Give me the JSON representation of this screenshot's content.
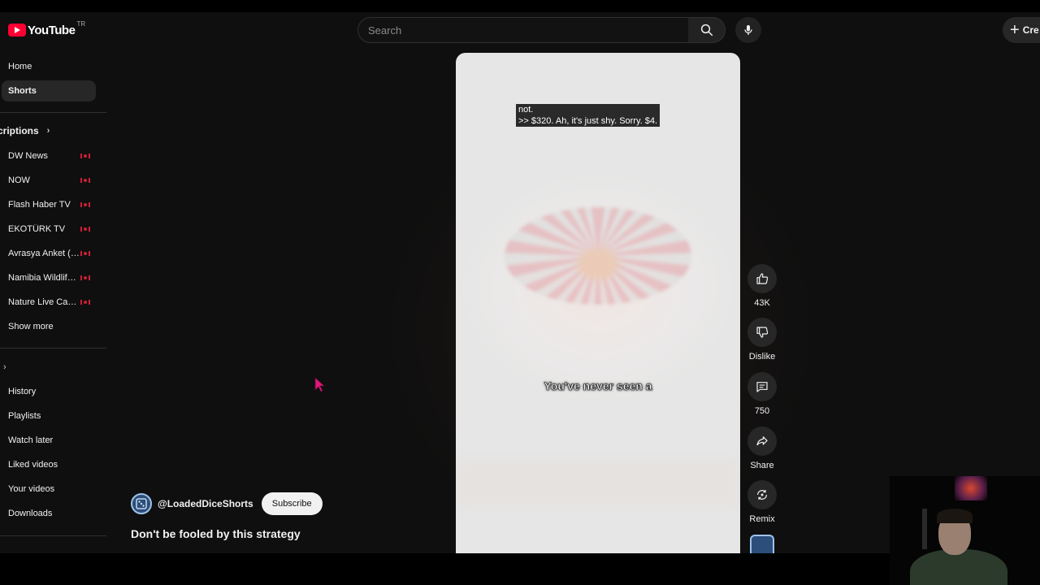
{
  "header": {
    "logo_text": "YouTube",
    "logo_country": "TR",
    "search_placeholder": "Search",
    "create_label": "Cre"
  },
  "sidebar": {
    "home": "Home",
    "shorts": "Shorts",
    "subscriptions_heading": "criptions",
    "subscriptions": [
      {
        "label": "DW News"
      },
      {
        "label": "NOW"
      },
      {
        "label": "Flash Haber TV"
      },
      {
        "label": "EKOTÜRK TV"
      },
      {
        "label": "Avrasya Anket (K..."
      },
      {
        "label": "Namibia Wildlife ..."
      },
      {
        "label": "Nature Live Cam..."
      }
    ],
    "show_more": "Show more",
    "you_items": [
      "History",
      "Playlists",
      "Watch later",
      "Liked videos",
      "Your videos",
      "Downloads"
    ]
  },
  "video": {
    "caption_text": "not.\n>> $320. Ah, it's just shy. Sorry. $4.",
    "overlay_text": "You've never seen a"
  },
  "channel": {
    "handle": "@LoadedDiceShorts",
    "subscribe_label": "Subscribe",
    "short_title": "Don't be fooled by this strategy"
  },
  "actions": {
    "like_count": "43K",
    "dislike_label": "Dislike",
    "comment_count": "750",
    "share_label": "Share",
    "remix_label": "Remix"
  },
  "colors": {
    "background": "#0f0f0f",
    "brand_red": "#ff0033",
    "live_indicator": "#cc1f35"
  }
}
